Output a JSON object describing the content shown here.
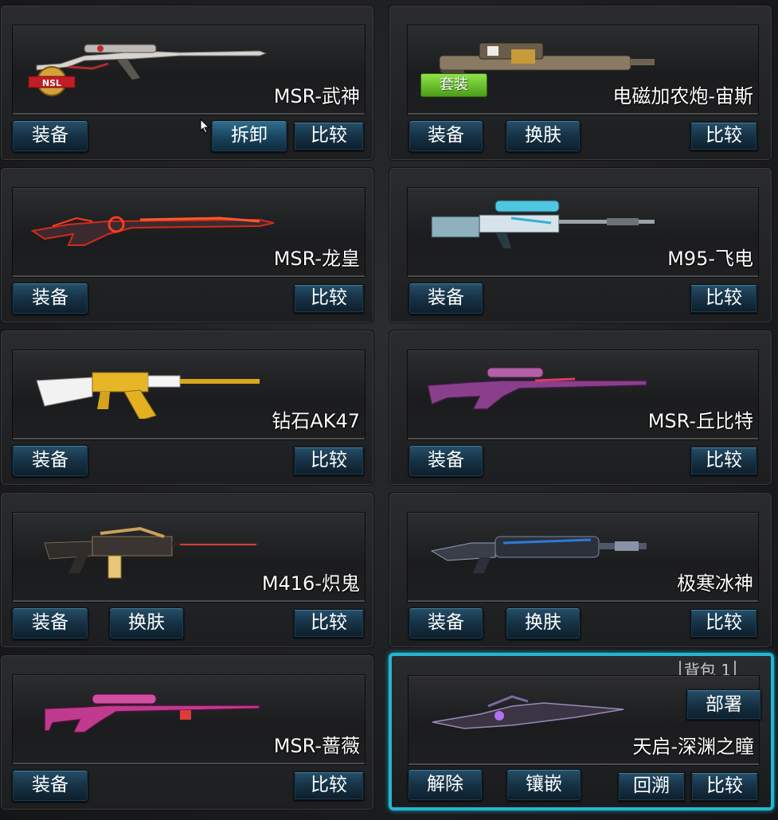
{
  "colors": {
    "accent": "#22b6d3",
    "button": "#173448",
    "suit_badge": "#6cc234"
  },
  "slots": [
    {
      "name": "MSR-武神",
      "buttons": [
        "装备",
        "拆卸",
        "比较"
      ],
      "badge": "NSL"
    },
    {
      "name": "电磁加农炮-宙斯",
      "buttons": [
        "装备",
        "换肤",
        "比较"
      ],
      "badge": "套装"
    },
    {
      "name": "MSR-龙皇",
      "buttons": [
        "装备",
        "比较"
      ]
    },
    {
      "name": "M95-飞电",
      "buttons": [
        "装备",
        "比较"
      ]
    },
    {
      "name": "钻石AK47",
      "buttons": [
        "装备",
        "比较"
      ]
    },
    {
      "name": "MSR-丘比特",
      "buttons": [
        "装备",
        "比较"
      ]
    },
    {
      "name": "M416-炽鬼",
      "buttons": [
        "装备",
        "换肤",
        "比较"
      ]
    },
    {
      "name": "极寒冰神",
      "buttons": [
        "装备",
        "换肤",
        "比较"
      ]
    },
    {
      "name": "MSR-蔷薇",
      "buttons": [
        "装备",
        "比较"
      ]
    },
    {
      "name": "天启-深渊之瞳",
      "buttons": [
        "解除",
        "镶嵌",
        "回溯",
        "比较",
        "部署"
      ],
      "pack_label": "背包 1",
      "selected": true
    }
  ]
}
